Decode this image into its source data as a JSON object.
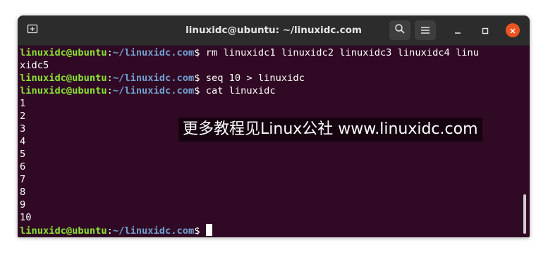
{
  "window": {
    "title": "linuxidc@ubuntu: ~/linuxidc.com"
  },
  "icons": {
    "new_tab": "new-tab-icon",
    "search": "search-icon",
    "menu": "hamburger-menu-icon",
    "minimize": "minimize-icon",
    "maximize": "maximize-icon",
    "close": "close-icon"
  },
  "colors": {
    "terminal_bg": "#300a24",
    "user_host": "#8ae234",
    "path": "#729fcf",
    "close_button": "#e95420"
  },
  "terminal": {
    "user_host": "linuxidc@ubuntu",
    "colon": ":",
    "path": "~/linuxidc.com",
    "prompt_symbol": "$",
    "commands": [
      " rm linuxidc1 linuxidc2 linuxidc3 linuxidc4 linu",
      " seq 10 > linuxidc",
      " cat linuxidc"
    ],
    "wrap": "xidc5",
    "output": [
      "1",
      "2",
      "3",
      "4",
      "5",
      "6",
      "7",
      "8",
      "9",
      "10"
    ]
  },
  "watermark": {
    "text": "更多教程见Linux公社 www.linuxidc.com"
  }
}
